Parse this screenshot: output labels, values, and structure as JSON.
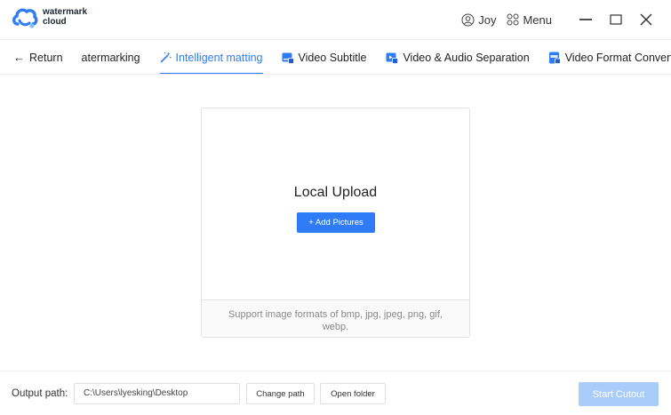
{
  "app": {
    "brand_line1": "watermark",
    "brand_line2": "cloud",
    "accent_color": "#2f7cf6",
    "disabled_accent_color": "#a9ccfb"
  },
  "header": {
    "user_name": "Joy",
    "menu_label": "Menu",
    "icons": [
      "user-circle-icon",
      "grid-menu-icon",
      "minimize-icon",
      "maximize-icon",
      "close-icon"
    ]
  },
  "nav": {
    "return_label": "Return",
    "tabs": [
      {
        "label": "atermarking",
        "icon": null,
        "active": false
      },
      {
        "label": "Intelligent matting",
        "icon": "magic-wand-icon",
        "active": true
      },
      {
        "label": "Video Subtitle",
        "icon": "video-subtitle-icon",
        "active": false
      },
      {
        "label": "Video & Audio Separation",
        "icon": "video-audio-icon",
        "active": false
      },
      {
        "label": "Video Format Converting",
        "icon": "video-format-icon",
        "active": false
      }
    ]
  },
  "upload": {
    "title": "Local Upload",
    "add_button": "+ Add Pictures",
    "hint": "Support image formats of bmp, jpg, jpeg, png, gif, webp."
  },
  "footer": {
    "output_label": "Output path:",
    "output_path": "C:\\Users\\lyesking\\Desktop",
    "change_path": "Change path",
    "open_folder": "Open folder",
    "start_button": "Start Cutout"
  }
}
